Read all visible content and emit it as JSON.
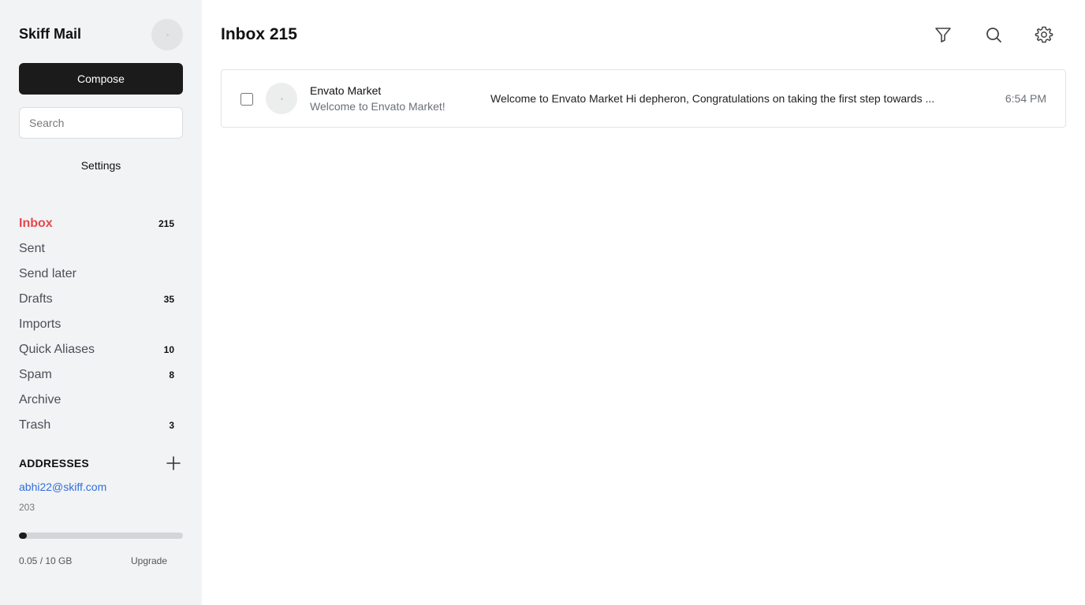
{
  "app": {
    "name": "Skiff Mail"
  },
  "sidebar": {
    "compose_label": "Compose",
    "search_placeholder": "Search",
    "settings_label": "Settings",
    "folders": [
      {
        "label": "Inbox",
        "count": "215",
        "active": true
      },
      {
        "label": "Sent",
        "count": ""
      },
      {
        "label": "Send later",
        "count": ""
      },
      {
        "label": "Drafts",
        "count": "35"
      },
      {
        "label": "Imports",
        "count": ""
      },
      {
        "label": "Quick Aliases",
        "count": "10"
      },
      {
        "label": "Spam",
        "count": "8"
      },
      {
        "label": "Archive",
        "count": ""
      },
      {
        "label": "Trash",
        "count": "3"
      }
    ],
    "addresses_heading": "ADDRESSES",
    "address": "abhi22@skiff.com",
    "address_count": "203",
    "storage_text": "0.05 / 10 GB",
    "storage_fraction": 0.005,
    "upgrade_label": "Upgrade"
  },
  "main": {
    "title": "Inbox 215",
    "toolbar_icons": [
      "filter-icon",
      "search-icon",
      "gear-icon"
    ],
    "emails": [
      {
        "sender": "Envato Market",
        "subject": "Welcome to Envato Market!",
        "preview": "Welcome to Envato Market Hi depheron, Congratulations on taking the first step towards ...",
        "time": "6:54 PM"
      }
    ]
  },
  "colors": {
    "sidebar_bg": "#f2f3f5",
    "active_folder": "#e5484d",
    "link": "#2f6fdc",
    "compose_bg": "#1b1b1b"
  }
}
